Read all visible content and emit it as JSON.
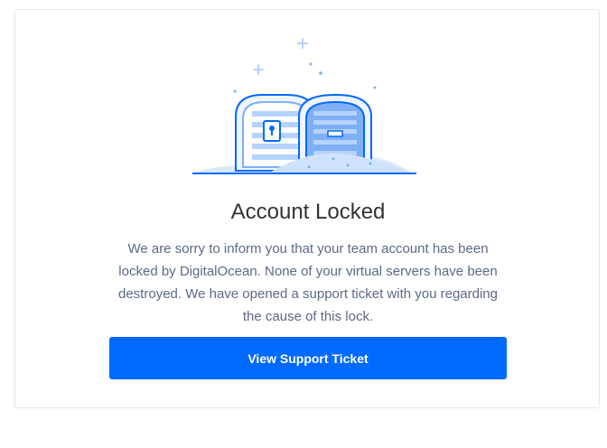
{
  "dialog": {
    "title": "Account Locked",
    "message": "We are sorry to inform you that your team account has been locked by DigitalOcean. None of your virtual servers have been destroyed. We have opened a support ticket with you regarding the cause of this lock.",
    "button_label": "View Support Ticket"
  },
  "colors": {
    "accent": "#0069ff",
    "illustration_light": "#b5d3ff",
    "illustration_mid": "#7fb0f5",
    "text_title": "#333333",
    "text_body": "#5b6987"
  },
  "icons": {
    "illustration": "locked-treasure-chest-icon"
  }
}
